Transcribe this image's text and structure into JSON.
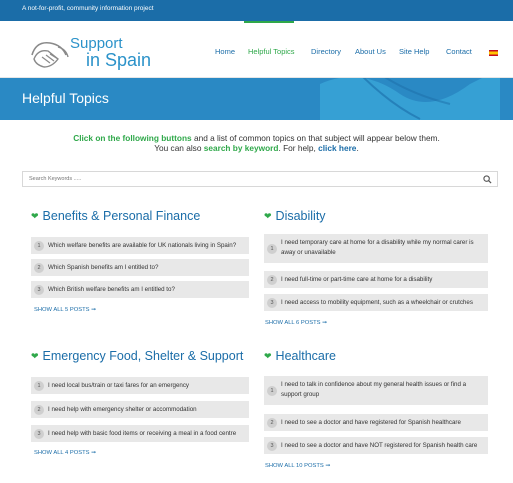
{
  "topbar": {
    "tagline": "A not-for-profit, community information project"
  },
  "header": {
    "logo": {
      "line1": "Support",
      "line2": "in Spain"
    },
    "nav": [
      "Home",
      "Helpful Topics",
      "Directory",
      "About Us",
      "Site Help",
      "Contact"
    ],
    "active_nav": "Helpful Topics"
  },
  "banner": {
    "title": "Helpful Topics"
  },
  "intro": {
    "line1_highlight": "Click on the following buttons",
    "line1_rest": " and a list of common topics on that subject will appear below them.",
    "line2_pre": "You can also ",
    "line2_link1": "search by keyword",
    "line2_mid": ". For help, ",
    "line2_link2": "click here",
    "line2_end": "."
  },
  "search": {
    "placeholder": "Search Keywords ....."
  },
  "sections": [
    {
      "title": "Benefits & Personal Finance",
      "items": [
        "Which welfare benefits are available for UK nationals living in Spain?",
        "Which Spanish benefits am I entitled to?",
        "Which British welfare benefits am I entitled to?"
      ],
      "show_all": "SHOW ALL 5 POSTS ➞"
    },
    {
      "title": "Disability",
      "items": [
        "I need temporary care at home for a disability while my normal carer is away or unavailable",
        "I need full-time or part-time care at home for a disability",
        "I need access to mobility equipment, such as a wheelchair or crutches"
      ],
      "show_all": "SHOW ALL 6 POSTS ➞"
    },
    {
      "title": "Emergency Food, Shelter & Support",
      "items": [
        "I need local bus/train or taxi fares for an emergency",
        "I need help with emergency shelter or accommodation",
        "I need help with basic food items or receiving a meal in a food centre"
      ],
      "show_all": "SHOW ALL 4 POSTS ➞"
    },
    {
      "title": "Healthcare",
      "items": [
        "I need to talk in confidence about my general health issues or find a support group",
        "I need to see a doctor and have registered for Spanish healthcare",
        "I need to see a doctor and have NOT registered for Spanish health care"
      ],
      "show_all": "SHOW ALL 10 POSTS ➞"
    }
  ],
  "item_numbers": [
    "1",
    "2",
    "3"
  ],
  "colors": {
    "primary_blue": "#1b6da8",
    "accent_green": "#2fa84a",
    "banner_blue": "#2a89c4"
  }
}
